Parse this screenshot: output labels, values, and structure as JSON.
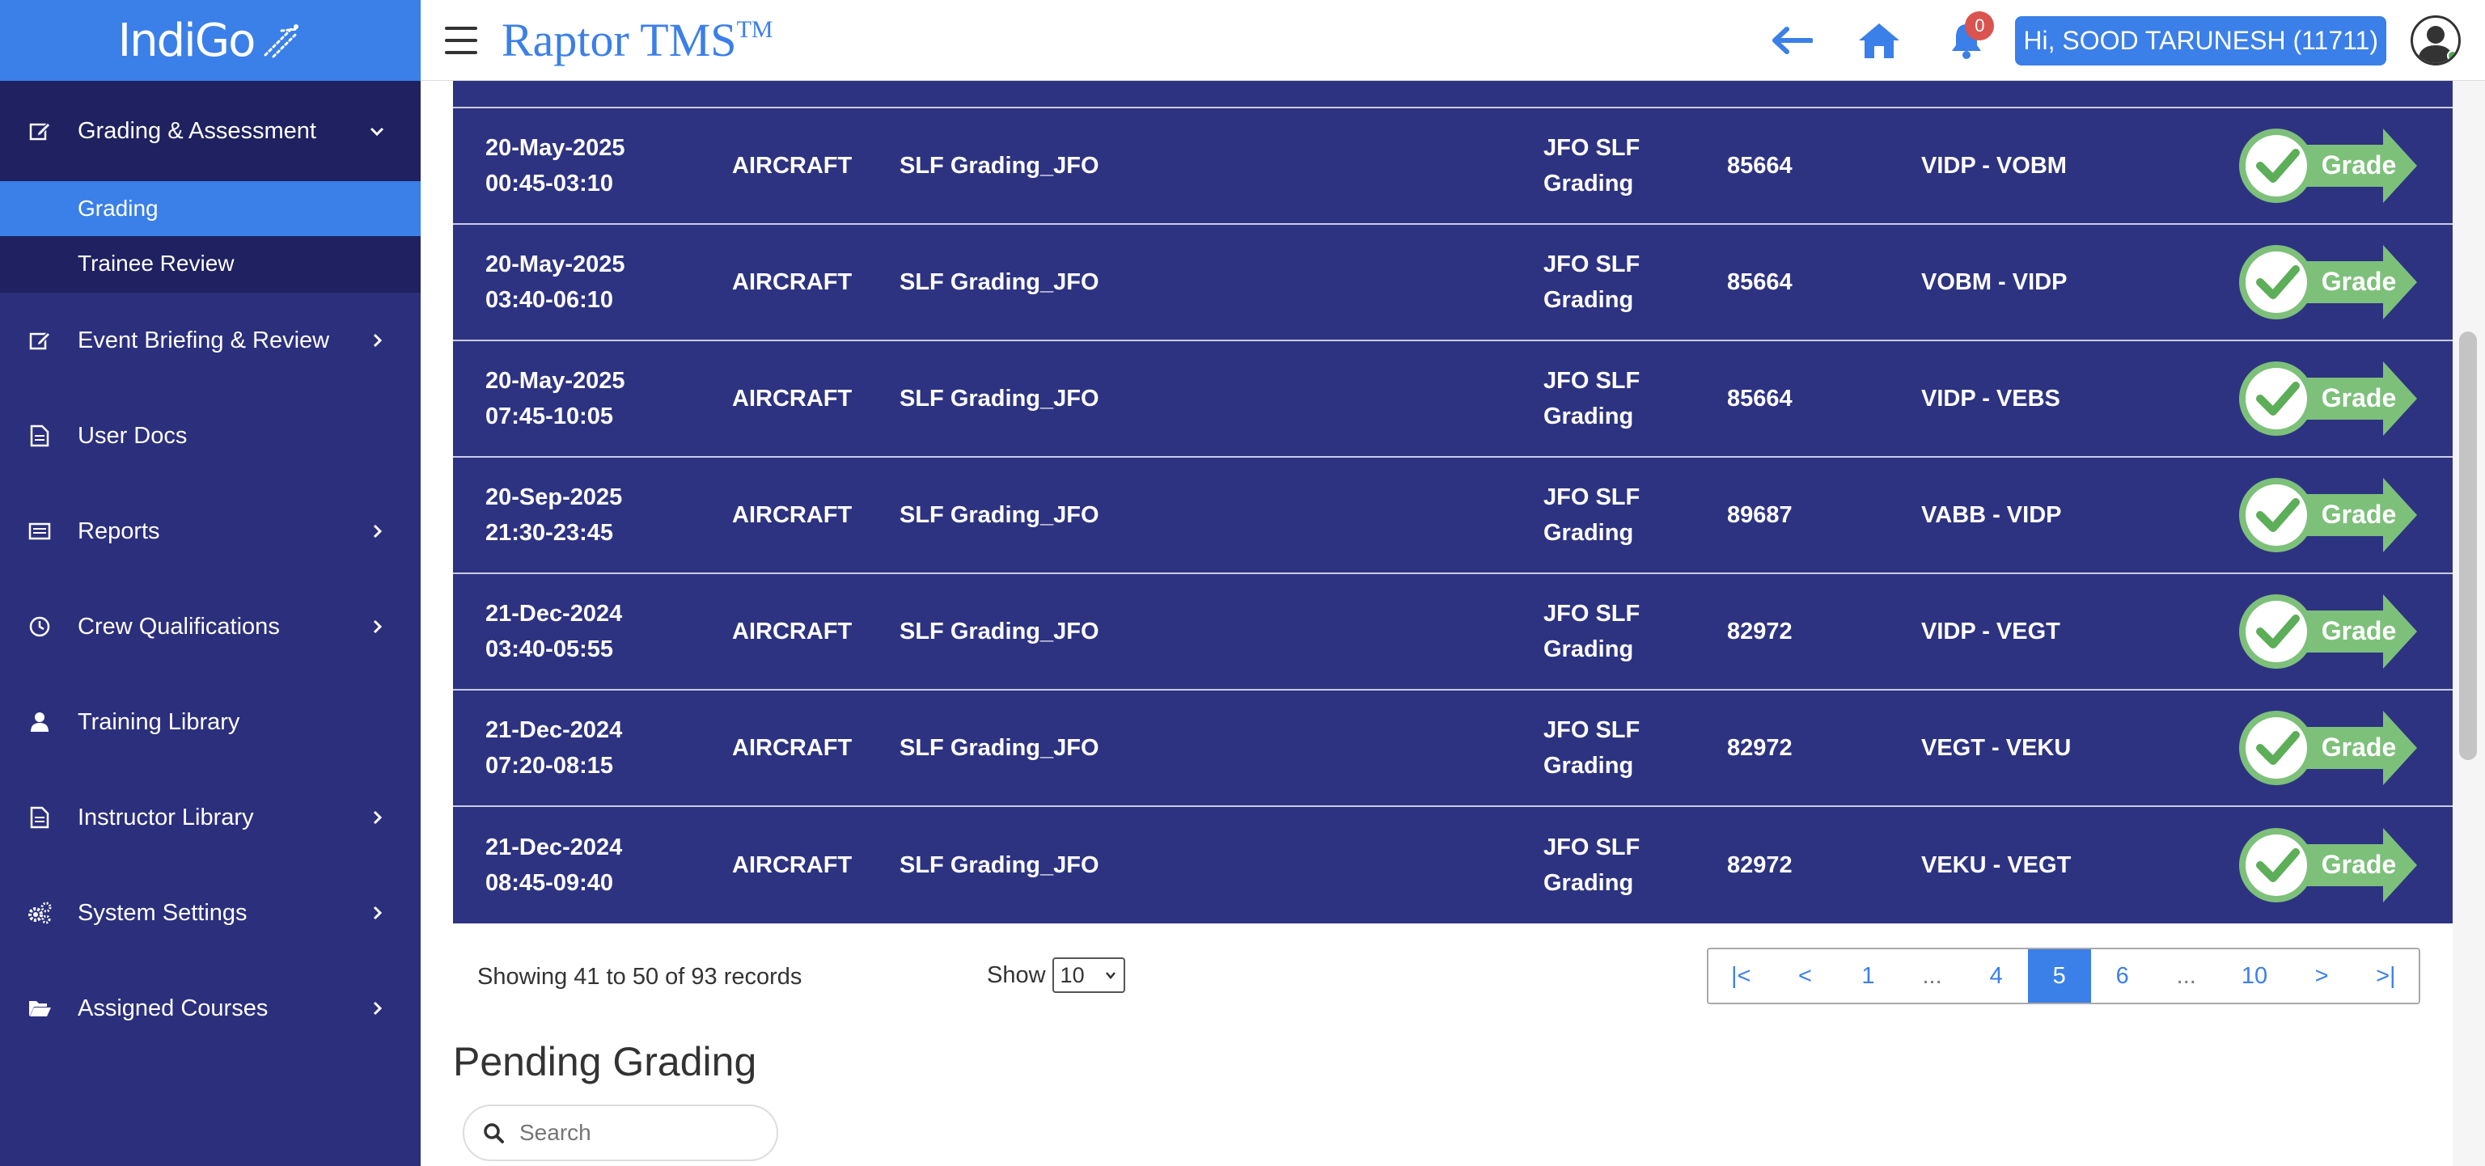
{
  "sidebar": {
    "brand": "IndiGo",
    "items": [
      {
        "label": "Grading & Assessment",
        "icon": "edit-icon",
        "open": true
      },
      {
        "label": "Event Briefing & Review",
        "icon": "edit-icon"
      },
      {
        "label": "User Docs",
        "icon": "document-icon"
      },
      {
        "label": "Reports",
        "icon": "report-icon"
      },
      {
        "label": "Crew Qualifications",
        "icon": "clock-icon"
      },
      {
        "label": "Training Library",
        "icon": "user-icon"
      },
      {
        "label": "Instructor Library",
        "icon": "document-icon"
      },
      {
        "label": "System Settings",
        "icon": "gears-icon"
      },
      {
        "label": "Assigned Courses",
        "icon": "folder-open-icon"
      }
    ],
    "subitems": [
      {
        "label": "Grading",
        "active": true
      },
      {
        "label": "Trainee Review",
        "active": false
      }
    ]
  },
  "header": {
    "title": "Raptor TMS",
    "title_tm": "TM",
    "notifications": "0",
    "user": "Hi, SOOD TARUNESH (11711)"
  },
  "table": {
    "rows": [
      {
        "date": "20-May-2025",
        "time": "00:45-03:10",
        "type": "AIRCRAFT",
        "event": "SLF Grading_JFO",
        "desc1": "JFO SLF",
        "desc2": "Grading",
        "flight": "85664",
        "route": "VIDP - VOBM",
        "action": "Grade"
      },
      {
        "date": "20-May-2025",
        "time": "03:40-06:10",
        "type": "AIRCRAFT",
        "event": "SLF Grading_JFO",
        "desc1": "JFO SLF",
        "desc2": "Grading",
        "flight": "85664",
        "route": "VOBM - VIDP",
        "action": "Grade"
      },
      {
        "date": "20-May-2025",
        "time": "07:45-10:05",
        "type": "AIRCRAFT",
        "event": "SLF Grading_JFO",
        "desc1": "JFO SLF",
        "desc2": "Grading",
        "flight": "85664",
        "route": "VIDP - VEBS",
        "action": "Grade"
      },
      {
        "date": "20-Sep-2025",
        "time": "21:30-23:45",
        "type": "AIRCRAFT",
        "event": "SLF Grading_JFO",
        "desc1": "JFO SLF",
        "desc2": "Grading",
        "flight": "89687",
        "route": "VABB - VIDP",
        "action": "Grade"
      },
      {
        "date": "21-Dec-2024",
        "time": "03:40-05:55",
        "type": "AIRCRAFT",
        "event": "SLF Grading_JFO",
        "desc1": "JFO SLF",
        "desc2": "Grading",
        "flight": "82972",
        "route": "VIDP - VEGT",
        "action": "Grade"
      },
      {
        "date": "21-Dec-2024",
        "time": "07:20-08:15",
        "type": "AIRCRAFT",
        "event": "SLF Grading_JFO",
        "desc1": "JFO SLF",
        "desc2": "Grading",
        "flight": "82972",
        "route": "VEGT - VEKU",
        "action": "Grade"
      },
      {
        "date": "21-Dec-2024",
        "time": "08:45-09:40",
        "type": "AIRCRAFT",
        "event": "SLF Grading_JFO",
        "desc1": "JFO SLF",
        "desc2": "Grading",
        "flight": "82972",
        "route": "VEKU - VEGT",
        "action": "Grade"
      }
    ]
  },
  "pagination": {
    "summary": "Showing 41 to 50 of 93 records",
    "show_label": "Show",
    "page_size": "10",
    "pages": [
      "|<",
      "<",
      "1",
      "...",
      "4",
      "5",
      "6",
      "...",
      "10",
      ">",
      ">|"
    ],
    "active": "5"
  },
  "pending": {
    "title": "Pending Grading",
    "search_placeholder": "Search"
  },
  "colors": {
    "sidebar": "#2c2f7c",
    "accent": "#3b7fe8",
    "table": "#2d3381",
    "grade_green": "#7dc07a"
  }
}
